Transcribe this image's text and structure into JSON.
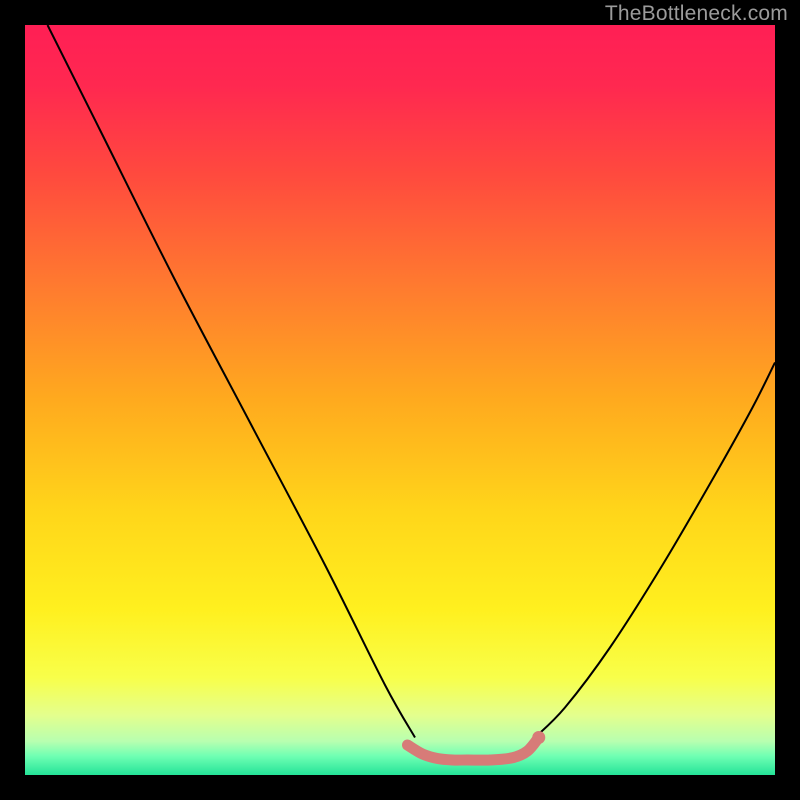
{
  "watermark": "TheBottleneck.com",
  "chart_data": {
    "type": "line",
    "title": "",
    "xlabel": "",
    "ylabel": "",
    "xlim": [
      0,
      100
    ],
    "ylim": [
      0,
      100
    ],
    "background_gradient_stops": [
      {
        "pos": 0.0,
        "color": "#ff1f55"
      },
      {
        "pos": 0.08,
        "color": "#ff2850"
      },
      {
        "pos": 0.2,
        "color": "#ff4a3e"
      },
      {
        "pos": 0.35,
        "color": "#ff7b2f"
      },
      {
        "pos": 0.5,
        "color": "#ffaa1e"
      },
      {
        "pos": 0.65,
        "color": "#ffd61a"
      },
      {
        "pos": 0.78,
        "color": "#fff01f"
      },
      {
        "pos": 0.87,
        "color": "#f8ff4a"
      },
      {
        "pos": 0.92,
        "color": "#e4ff8d"
      },
      {
        "pos": 0.955,
        "color": "#b8ffb0"
      },
      {
        "pos": 0.975,
        "color": "#6fffb3"
      },
      {
        "pos": 1.0,
        "color": "#24e398"
      }
    ],
    "series": [
      {
        "name": "left-branch",
        "stroke": "#000000",
        "stroke_width": 2,
        "x": [
          3,
          10,
          20,
          30,
          40,
          48,
          52
        ],
        "y": [
          100,
          86,
          66,
          47,
          28,
          12,
          5
        ]
      },
      {
        "name": "right-branch",
        "stroke": "#000000",
        "stroke_width": 2,
        "x": [
          68,
          72,
          78,
          85,
          92,
          97,
          100
        ],
        "y": [
          5,
          9,
          17,
          28,
          40,
          49,
          55
        ]
      },
      {
        "name": "valley-highlight",
        "stroke": "#d77b78",
        "stroke_width": 11,
        "linecap": "round",
        "x": [
          51,
          53,
          55,
          57,
          59,
          62,
          65,
          67,
          68.5
        ],
        "y": [
          4.0,
          2.8,
          2.2,
          2.0,
          2.0,
          2.0,
          2.3,
          3.2,
          5.0
        ]
      }
    ],
    "markers": [
      {
        "name": "valley-end-dot",
        "x": 68.5,
        "y": 5.0,
        "r": 6.5,
        "fill": "#d77b78"
      }
    ]
  }
}
